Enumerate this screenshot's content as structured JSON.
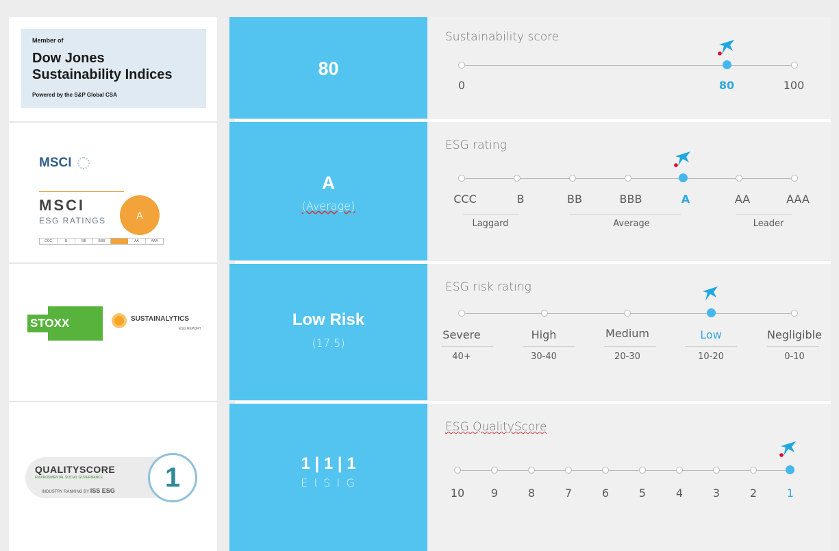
{
  "colors": {
    "accent": "#53c4f0",
    "active_text": "#2fa8e0",
    "brand_red": "#e4002b"
  },
  "logos": {
    "djsi": {
      "line1": "Member of",
      "line2": "Dow Jones",
      "line3": "Sustainability Indices",
      "line4": "Powered by the S&P Global CSA"
    },
    "msci": {
      "top": "MSCI",
      "brand": "MSCI",
      "sub": "ESG RATINGS",
      "badge": "A",
      "scale": [
        "CCC",
        "B",
        "BB",
        "BBB",
        "A",
        "AA",
        "AAA"
      ]
    },
    "stoxx": {
      "brand": "STOXX",
      "partner": "SUSTAINALYTICS",
      "partner_sub": "ESG REPORT"
    },
    "qualityscore": {
      "brand": "QUALITYSCORE",
      "tagline": "ENVIRONMENTAL SOCIAL GOVERNANCE",
      "provider": "INDUSTRY RANKING BY",
      "provider_brand": "ISS ESG",
      "badge": "1"
    }
  },
  "rows": [
    {
      "score_main": "80",
      "title": "Sustainability score",
      "ticks": [
        "0",
        "80",
        "100"
      ],
      "position": 0.8
    },
    {
      "score_main": "A",
      "score_sub": "(Average)",
      "title": "ESG rating",
      "ticks": [
        "CCC",
        "B",
        "BB",
        "BBB",
        "A",
        "AA",
        "AAA"
      ],
      "groups": [
        "Laggard",
        "Average",
        "Leader"
      ],
      "active_index": 4
    },
    {
      "score_main": "Low Risk",
      "score_sub": "(17.5)",
      "title": "ESG risk rating",
      "ticks": [
        "Severe",
        "High",
        "Medium",
        "Low",
        "Negligible"
      ],
      "ranges": [
        "40+",
        "30-40",
        "20-30",
        "10-20",
        "0-10"
      ],
      "active_index": 3
    },
    {
      "score_main": "1 | 1 | 1",
      "score_sub": "E I S I G",
      "title": "ESG QualityScore",
      "ticks": [
        "10",
        "9",
        "8",
        "7",
        "6",
        "5",
        "4",
        "3",
        "2",
        "1"
      ],
      "active_index": 9
    }
  ]
}
